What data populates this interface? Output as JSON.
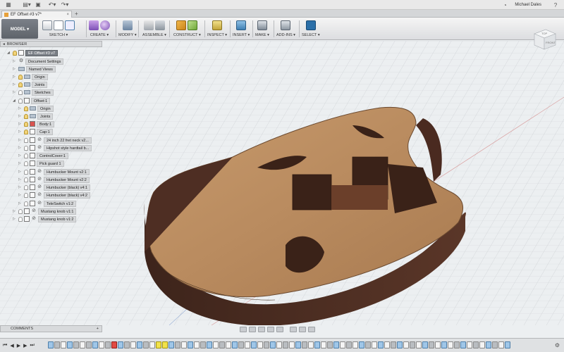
{
  "app": {
    "user_name": "Michael Dales",
    "icons": [
      "grid-icon",
      "file-icon",
      "save-icon",
      "undo-icon",
      "redo-icon",
      "clock-icon",
      "help-icon"
    ]
  },
  "tab": {
    "title": "EF Offset #3 v7*",
    "close": "×",
    "add": "+"
  },
  "ribbon": {
    "workspace": "MODEL ▾",
    "groups": [
      {
        "label": "SKETCH ▾"
      },
      {
        "label": "CREATE ▾"
      },
      {
        "label": "MODIFY ▾"
      },
      {
        "label": "ASSEMBLE ▾"
      },
      {
        "label": "CONSTRUCT ▾"
      },
      {
        "label": "INSPECT ▾"
      },
      {
        "label": "INSERT ▾"
      },
      {
        "label": "MAKE ▾"
      },
      {
        "label": "ADD-INS ▾"
      },
      {
        "label": "SELECT ▾"
      }
    ]
  },
  "browser": {
    "header": "BROWSER",
    "root": "EF Offset #3 v7",
    "items": [
      {
        "label": "Document Settings"
      },
      {
        "label": "Named Views"
      },
      {
        "label": "Origin"
      },
      {
        "label": "Joints"
      },
      {
        "label": "Sketches"
      },
      {
        "label": "Offset:1"
      },
      {
        "label": "Origin"
      },
      {
        "label": "Joints"
      },
      {
        "label": "Body:1"
      },
      {
        "label": "Cap:1"
      },
      {
        "label": "24 inch 22 fret neck v2..."
      },
      {
        "label": "Hipshot style hardtail b..."
      },
      {
        "label": "ControlCover:1"
      },
      {
        "label": "Pick guard 1"
      },
      {
        "label": "Humbucker Mount v2:1"
      },
      {
        "label": "Humbucker Mount v2:2"
      },
      {
        "label": "Humbucker (black) v4:1"
      },
      {
        "label": "Humbucker (black) v4:2"
      },
      {
        "label": "TeleSwitch v1:2"
      },
      {
        "label": "Mustang knob v1:1"
      },
      {
        "label": "Mustang knob v1:2"
      }
    ]
  },
  "viewcube": {
    "top": "TOP",
    "front": "FRONT"
  },
  "comments": {
    "label": "COMMENTS",
    "add": "+"
  },
  "timeline": {
    "controls": [
      "⏮",
      "◀",
      "▶",
      "▶",
      "⏭"
    ],
    "gear": "⚙"
  },
  "colors": {
    "maple": "#b98b5f",
    "walnut": "#4e2e23",
    "select_blue": "#2b6fa8"
  }
}
